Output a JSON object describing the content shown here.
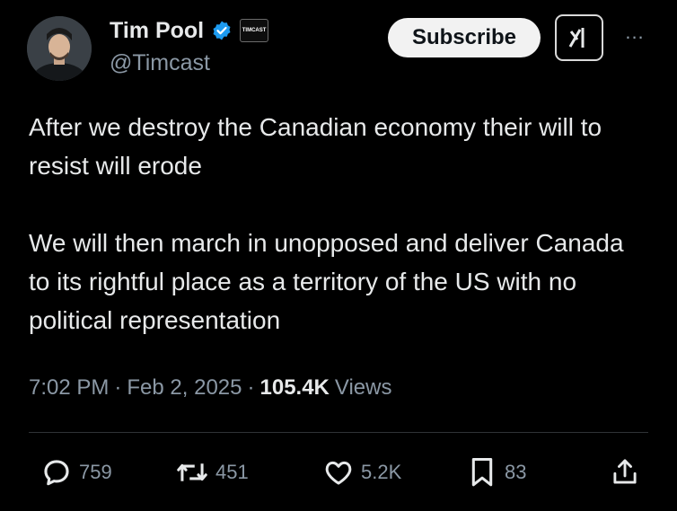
{
  "author": {
    "display_name": "Tim Pool",
    "handle": "@Timcast",
    "affiliate_badge_text": "TIMCAST",
    "verified_color": "#1d9bf0"
  },
  "header": {
    "subscribe_label": "Subscribe",
    "grok_icon": "grok-icon",
    "more_label": "..."
  },
  "tweet": {
    "paragraphs": [
      "After we destroy the Canadian economy their will to resist will erode",
      "We will then march in unopposed and  deliver Canada to its rightful place as a territory of the US with no political representation"
    ]
  },
  "meta": {
    "time": "7:02 PM",
    "sep1": "·",
    "date": "Feb 2, 2025",
    "sep2": "·",
    "views_count": "105.4K",
    "views_label": "Views"
  },
  "actions": {
    "replies": "759",
    "reposts": "451",
    "likes": "5.2K",
    "bookmarks": "83"
  },
  "colors": {
    "background": "#000000",
    "text": "#e7e9ea",
    "secondary": "#8b98a5"
  }
}
